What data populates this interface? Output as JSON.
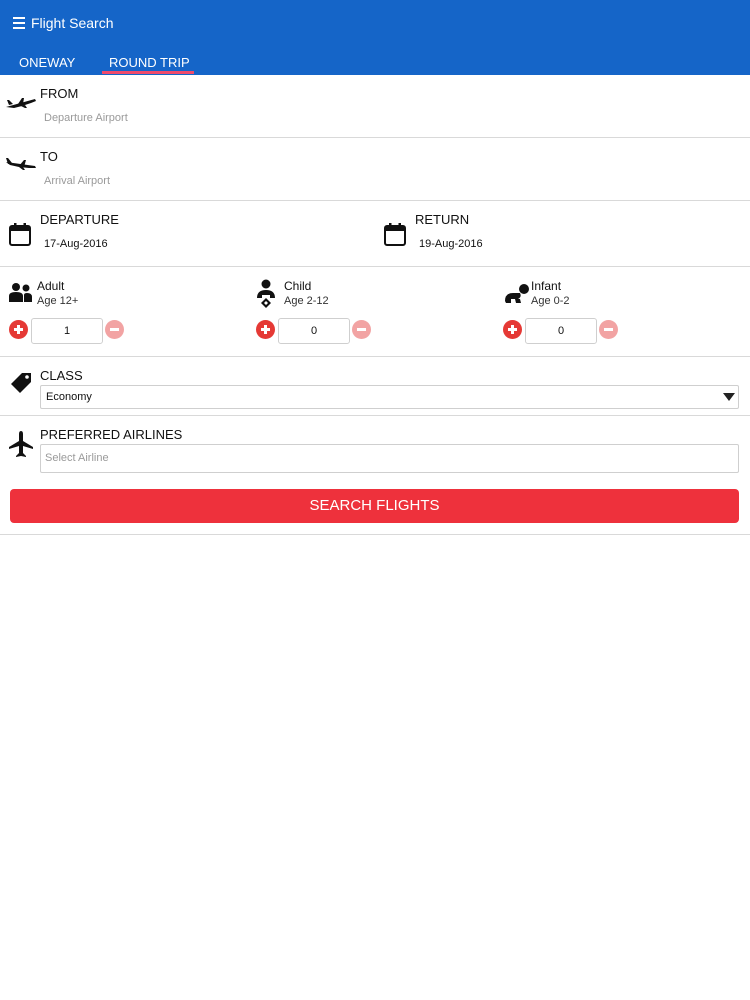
{
  "appbar": {
    "title": "Flight Search",
    "menu_icon": "hamburger-menu-icon",
    "color": "#1565c8"
  },
  "tabs": [
    {
      "label": "ONEWAY",
      "selected": false
    },
    {
      "label": "ROUND TRIP",
      "selected": true
    }
  ],
  "from": {
    "label": "FROM",
    "placeholder": "Departure Airport",
    "icon": "plane-departure-icon"
  },
  "to": {
    "label": "TO",
    "placeholder": "Arrival Airport",
    "icon": "plane-arrival-icon"
  },
  "departure": {
    "label": "DEPARTURE",
    "date": "17-Aug-2016",
    "icon": "calendar-icon"
  },
  "return": {
    "label": "RETURN",
    "date": "19-Aug-2016",
    "icon": "calendar-icon"
  },
  "passengers": {
    "adult": {
      "label": "Adult",
      "age": "Age 12+",
      "count": "1",
      "icon": "adult-icon"
    },
    "child": {
      "label": "Child",
      "age": "Age 2-12",
      "count": "0",
      "icon": "child-icon"
    },
    "infant": {
      "label": "Infant",
      "age": "Age 0-2",
      "count": "0",
      "icon": "infant-icon"
    }
  },
  "class": {
    "label": "CLASS",
    "value": "Economy",
    "icon": "tag-icon"
  },
  "airlines": {
    "label": "PREFERRED AIRLINES",
    "placeholder": "Select Airline",
    "icon": "airplane-icon"
  },
  "search_button": {
    "label": "SEARCH FLIGHTS",
    "color": "#ee313c"
  }
}
